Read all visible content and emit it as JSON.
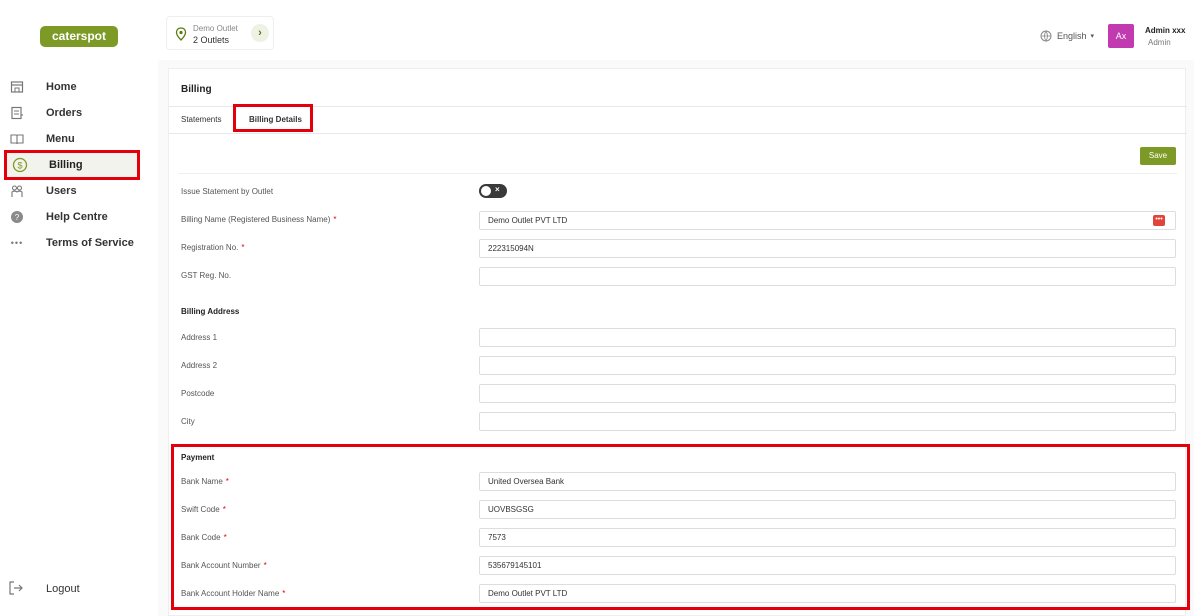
{
  "brand": {
    "logo_text": "caterspot",
    "accent": "#7c9a25",
    "highlight": "#e3000b"
  },
  "outlet": {
    "name": "Demo Outlet",
    "count": "2 Outlets",
    "go_icon": "chevron-right-icon"
  },
  "header": {
    "language": "English",
    "avatar_initials": "Ax",
    "user_name": "Admin xxx",
    "user_role": "Admin",
    "avatar_color": "#c23ab0"
  },
  "sidebar": {
    "items": [
      {
        "label": "Home",
        "icon": "store-icon"
      },
      {
        "label": "Orders",
        "icon": "receipt-icon"
      },
      {
        "label": "Menu",
        "icon": "book-icon"
      },
      {
        "label": "Billing",
        "icon": "dollar-icon",
        "active": true
      },
      {
        "label": "Users",
        "icon": "users-icon"
      },
      {
        "label": "Help Centre",
        "icon": "help-icon"
      },
      {
        "label": "Terms of Service",
        "icon": "dots-icon"
      }
    ],
    "logout": "Logout"
  },
  "page": {
    "title": "Billing",
    "tabs": [
      {
        "label": "Statements"
      },
      {
        "label": "Billing Details",
        "active": true
      }
    ],
    "save_label": "Save"
  },
  "form": {
    "issue_statement_label": "Issue Statement by Outlet",
    "issue_statement_value": false,
    "billing_name": {
      "label": "Billing Name (Registered Business Name)",
      "required": "*",
      "value": "Demo Outlet PVT LTD"
    },
    "registration_no": {
      "label": "Registration No.",
      "required": "*",
      "value": "222315094N"
    },
    "gst_reg_no": {
      "label": "GST Reg. No.",
      "value": ""
    },
    "billing_address_title": "Billing Address",
    "address1": {
      "label": "Address 1",
      "value": ""
    },
    "address2": {
      "label": "Address 2",
      "value": ""
    },
    "postcode": {
      "label": "Postcode",
      "value": ""
    },
    "city": {
      "label": "City",
      "value": ""
    },
    "payment_title": "Payment",
    "bank_name": {
      "label": "Bank Name",
      "required": "*",
      "value": "United Oversea Bank"
    },
    "swift_code": {
      "label": "Swift Code",
      "required": "*",
      "value": "UOVBSGSG"
    },
    "bank_code": {
      "label": "Bank Code",
      "required": "*",
      "value": "7573"
    },
    "bank_account_number": {
      "label": "Bank Account Number",
      "required": "*",
      "value": "535679145101"
    },
    "bank_account_holder": {
      "label": "Bank Account Holder Name",
      "required": "*",
      "value": "Demo Outlet PVT LTD"
    }
  }
}
